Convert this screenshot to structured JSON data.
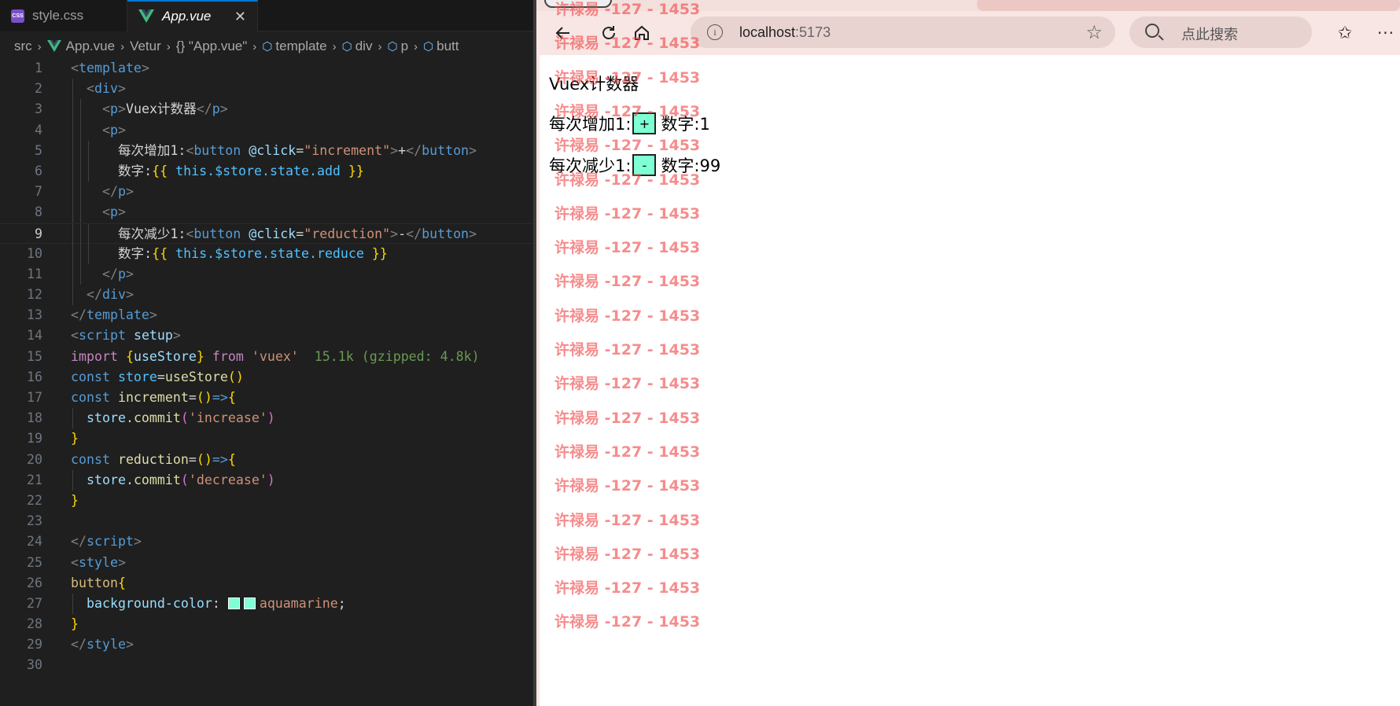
{
  "editor": {
    "tabs": [
      {
        "label": "style.css",
        "icon": "css-file-icon"
      },
      {
        "label": "App.vue",
        "icon": "vue-file-icon",
        "active": true
      }
    ],
    "close_glyph": "✕",
    "breadcrumb": [
      "src",
      "App.vue",
      "Vetur",
      "{} \"App.vue\"",
      "template",
      "div",
      "p",
      "butt"
    ],
    "active_line": 9,
    "line_numbers": [
      "1",
      "2",
      "3",
      "4",
      "5",
      "6",
      "7",
      "8",
      "9",
      "10",
      "11",
      "12",
      "13",
      "14",
      "15",
      "16",
      "17",
      "18",
      "19",
      "20",
      "21",
      "22",
      "23",
      "24",
      "25",
      "26",
      "27",
      "28",
      "29",
      "30"
    ],
    "code_text": {
      "l3_text": "Vuex计数器",
      "l5_text": "每次增加1:",
      "l5_attr_value": "\"increment\"",
      "l5_btn_text": "+",
      "l6_label": "数字:",
      "l6_expr": "this.$store.state.add",
      "l9_text": "每次减少1:",
      "l9_attr_value": "\"reduction\"",
      "l9_btn_text": "-",
      "l10_label": "数字:",
      "l10_expr": "this.$store.state.reduce",
      "l15_import": "'vuex'",
      "l15_size": "15.1k (gzipped: 4.8k)",
      "l18_arg": "'increase'",
      "l21_arg": "'decrease'",
      "l27_value": "aquamarine",
      "swatch_color": "#7fffd4"
    }
  },
  "browser": {
    "url_host": "localhost",
    "url_port": ":5173",
    "search_placeholder": "点此搜索",
    "page": {
      "title": "Vuex计数器",
      "inc_label": "每次增加1:",
      "inc_button": "+",
      "inc_value": "数字:1",
      "dec_label": "每次减少1:",
      "dec_button": "-",
      "dec_value": "数字:99"
    },
    "watermark": "许禄易 -127 - 1453",
    "button_color": "#7fffd4"
  }
}
